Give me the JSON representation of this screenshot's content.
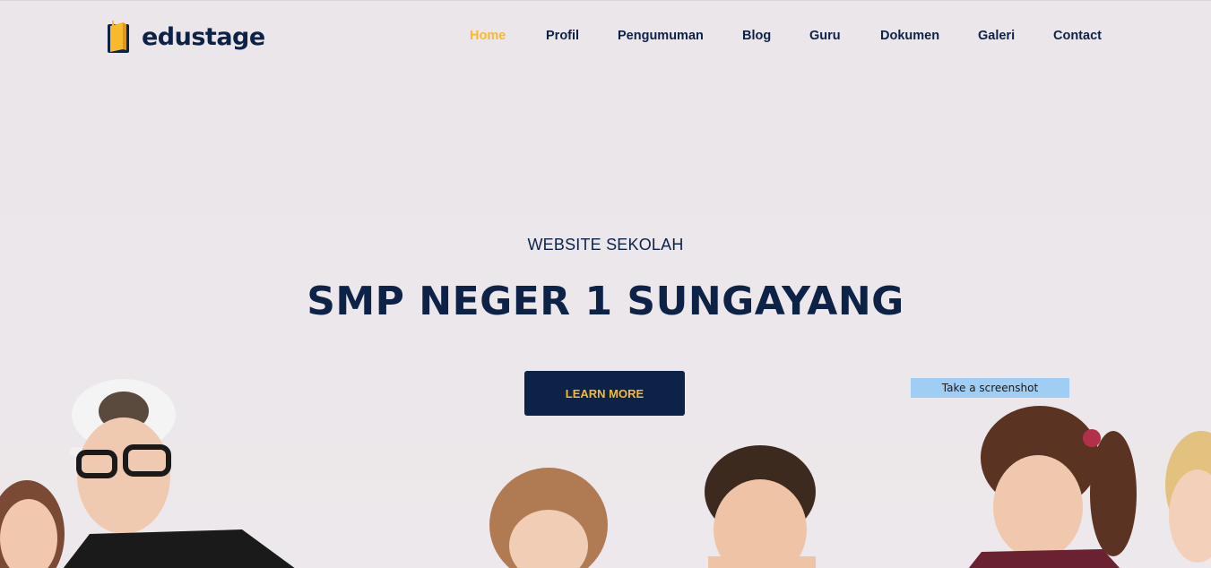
{
  "brand": {
    "name": "edustage",
    "logo_icon": "book-icon",
    "colors": {
      "navy": "#0d2247",
      "accent": "#f9b92d"
    }
  },
  "nav": {
    "items": [
      {
        "label": "Home",
        "active": true
      },
      {
        "label": "Profil",
        "active": false
      },
      {
        "label": "Pengumuman",
        "active": false
      },
      {
        "label": "Blog",
        "active": false
      },
      {
        "label": "Guru",
        "active": false
      },
      {
        "label": "Dokumen",
        "active": false
      },
      {
        "label": "Galeri",
        "active": false
      },
      {
        "label": "Contact",
        "active": false
      }
    ]
  },
  "hero": {
    "subtitle": "WEBSITE SEKOLAH",
    "title": "SMP NEGER 1 SUNGAYANG",
    "cta_label": "LEARN MORE"
  },
  "tooltip": {
    "text": "Take a screenshot"
  }
}
